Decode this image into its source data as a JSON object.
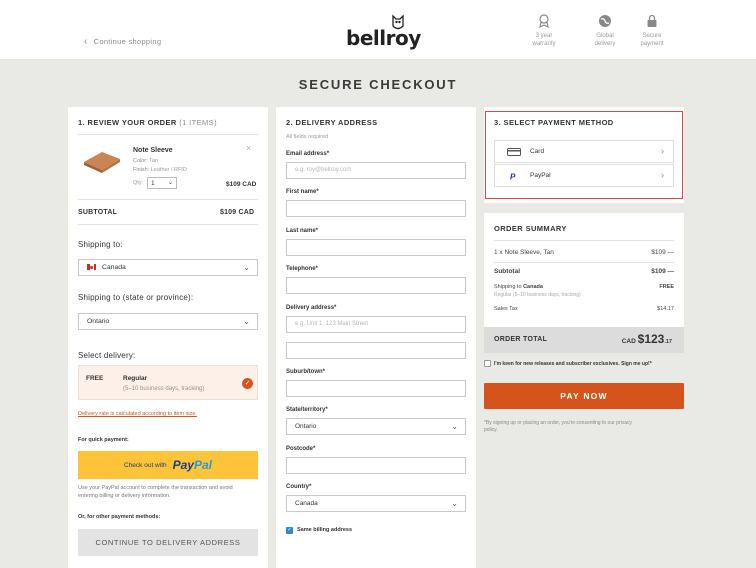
{
  "header": {
    "continue_label": "Continue shopping",
    "logo_text": "bellroy",
    "badges": [
      {
        "icon": "warranty-icon",
        "line1": "3 year",
        "line2": "warranty"
      },
      {
        "icon": "globe-icon",
        "line1": "Global",
        "line2": "delivery"
      },
      {
        "icon": "lock-icon",
        "line1": "Secure",
        "line2": "payment"
      }
    ]
  },
  "page_title": "SECURE CHECKOUT",
  "review": {
    "heading": "1. REVIEW YOUR ORDER",
    "count": "(1 ITEMS)",
    "product_name": "Note Sleeve",
    "color_label": "Color:",
    "color_value": "Tan",
    "finish_label": "Finish:",
    "finish_value": "Leather / RFID",
    "qty_label": "Qty:",
    "qty_value": "1",
    "price": "$109 CAD",
    "subtotal_label": "SUBTOTAL",
    "subtotal_value": "$109 CAD",
    "shipping_to_label": "Shipping to:",
    "country": "Canada",
    "state_label": "Shipping to (state or province):",
    "state": "Ontario",
    "delivery_label": "Select delivery:",
    "delivery_price": "FREE",
    "delivery_name": "Regular",
    "delivery_time": "(5–10 business days, tracking)",
    "rate_note": "Delivery rate is calculated according to item size.",
    "quick_pay_label": "For quick payment:",
    "paypal_checkout": "Check out with",
    "paypal_brand_a": "Pay",
    "paypal_brand_b": "Pal",
    "paypal_note_1": "Use your PayPal account to complete the transaction and avoid",
    "paypal_note_2": "entering billing or delivery information.",
    "other_methods": "Or, for other payment methods:",
    "continue_button": "CONTINUE TO DELIVERY ADDRESS"
  },
  "delivery": {
    "heading": "2. DELIVERY ADDRESS",
    "required_note": "All fields required",
    "email_label": "Email address*",
    "email_placeholder": "e.g. roy@bellroy.com",
    "first_name_label": "First name*",
    "last_name_label": "Last name*",
    "telephone_label": "Telephone*",
    "address_label": "Delivery address*",
    "address_placeholder": "e.g. Unit 1, 123 Main Street",
    "suburb_label": "Suburb/town*",
    "state_label": "State/territory*",
    "state_value": "Ontario",
    "postcode_label": "Postcode*",
    "country_label": "Country*",
    "country_value": "Canada",
    "same_billing": "Same billing address"
  },
  "payment": {
    "heading": "3. SELECT PAYMENT METHOD",
    "card_label": "Card",
    "paypal_label": "PayPal"
  },
  "summary": {
    "heading": "ORDER SUMMARY",
    "item": "1 x Note Sleeve, Tan",
    "item_price": "$109 —",
    "subtotal_label": "Subtotal",
    "subtotal_value": "$109 —",
    "shipping_label": "Shipping to",
    "shipping_country": "Canada",
    "shipping_detail": "Regular (5–10 business days, tracking)",
    "shipping_value": "FREE",
    "tax_label": "Sales Tax",
    "tax_value": "$14.17",
    "total_label": "ORDER TOTAL",
    "total_currency": "CAD",
    "total_main": "$123",
    "total_cents": ".17",
    "newsletter": "I'm keen for new releases and subscriber exclusives. Sign me up!*",
    "pay_button": "PAY NOW",
    "consent_1": "*By signing up or placing an order, you're consenting to our privacy",
    "consent_2": "policy."
  },
  "colors": {
    "accent": "#d5541c",
    "highlight": "#e0454c",
    "paypal_yellow": "#fdc439"
  }
}
